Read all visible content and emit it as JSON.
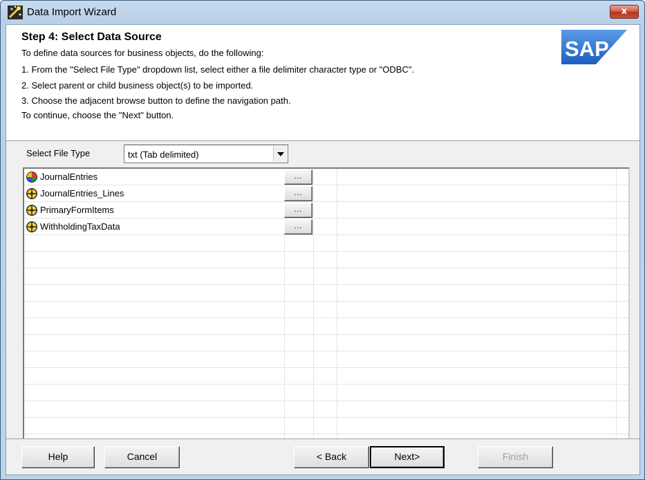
{
  "window": {
    "title": "Data Import Wizard",
    "close_glyph": "x"
  },
  "header": {
    "step_title": "Step 4: Select Data Source",
    "instructions": [
      "To define data sources for business objects, do the following:",
      "1. From the \"Select File Type\" dropdown list, select either a file delimiter character type or \"ODBC\".",
      "2. Select parent or child business object(s) to be imported.",
      "3. Choose the adjacent browse button to define the navigation path.",
      "To continue, choose the \"Next\" button."
    ],
    "logo_text": "SAP"
  },
  "file_type": {
    "label": "Select File Type",
    "selected": "txt (Tab delimited)"
  },
  "objects": [
    {
      "name": "JournalEntries",
      "icon": "parent-object-icon",
      "browse_label": "..."
    },
    {
      "name": "JournalEntries_Lines",
      "icon": "child-object-icon",
      "browse_label": "..."
    },
    {
      "name": "PrimaryFormItems",
      "icon": "child-object-icon",
      "browse_label": "..."
    },
    {
      "name": "WithholdingTaxData",
      "icon": "child-object-icon",
      "browse_label": "..."
    }
  ],
  "buttons": {
    "help": "Help",
    "cancel": "Cancel",
    "back": "< Back",
    "next": "Next>",
    "finish": "Finish"
  },
  "colors": {
    "window_frame": "#b9d0e8",
    "close_button": "#c9513a",
    "sap_blue": "#1d5fbf"
  }
}
